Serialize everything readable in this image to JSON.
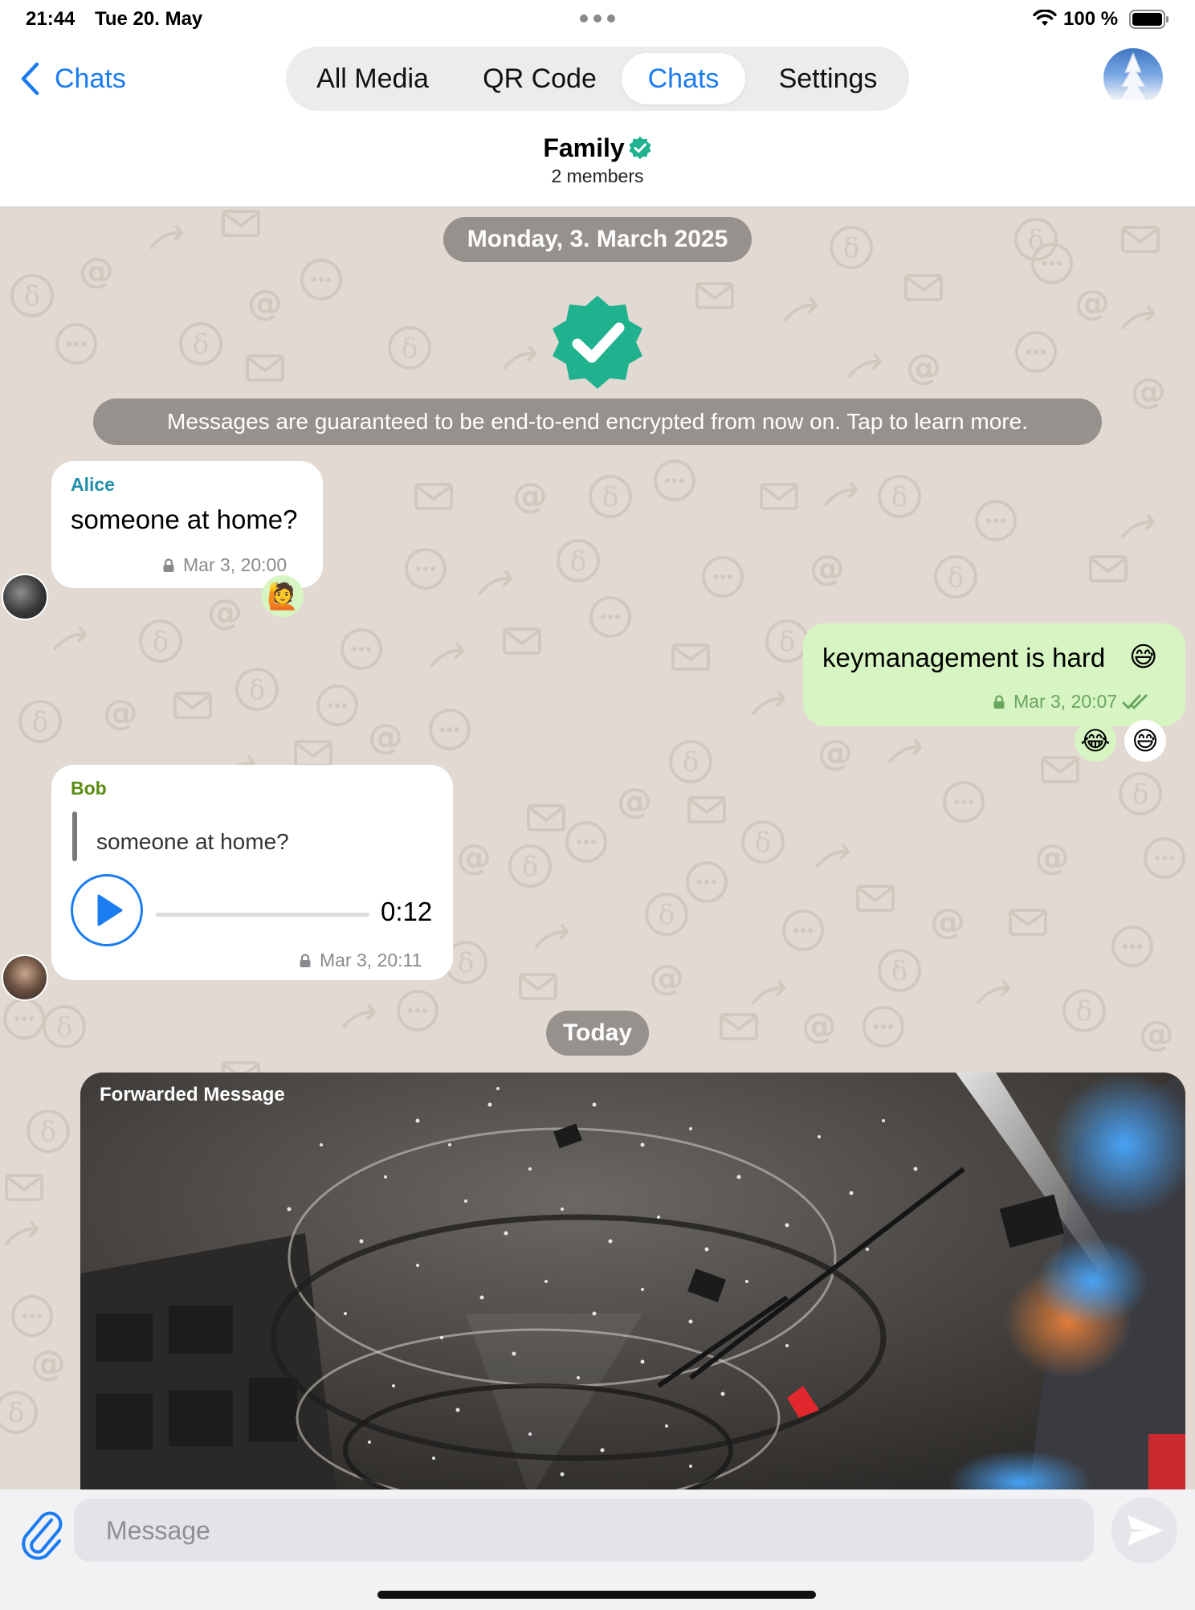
{
  "status_bar": {
    "time": "21:44",
    "date": "Tue 20. May",
    "battery": "100 %"
  },
  "nav": {
    "back_label": "Chats",
    "tabs": [
      {
        "label": "All Media"
      },
      {
        "label": "QR Code"
      },
      {
        "label": "Chats",
        "active": true
      },
      {
        "label": "Settings"
      }
    ],
    "chat_title": "Family",
    "chat_subtitle": "2 members"
  },
  "chat": {
    "date_separator": "Monday, 3. March 2025",
    "encryption_notice": "Messages are guaranteed to be end-to-end encrypted from now on. Tap to learn more.",
    "messages": [
      {
        "sender": "Alice",
        "sender_color": "#1f8fa8",
        "text": "someone at home?",
        "time": "Mar 3, 20:00",
        "reactions": [
          "🙋"
        ]
      },
      {
        "outgoing": true,
        "text": "keymanagement is hard",
        "emoji": "😅",
        "time": "Mar 3, 20:07",
        "reactions": [
          "😂",
          "😅"
        ]
      },
      {
        "sender": "Bob",
        "sender_color": "#5a8c12",
        "quote": "someone at home?",
        "audio_duration": "0:12",
        "time": "Mar 3, 20:11"
      }
    ],
    "today_separator": "Today",
    "forwarded_label": "Forwarded Message"
  },
  "composer": {
    "placeholder": "Message"
  },
  "colors": {
    "accent": "#1a7cf0",
    "verified": "#20b28f",
    "outgoing_bubble": "#d6f5c2",
    "chat_background": "#e2dad2"
  }
}
